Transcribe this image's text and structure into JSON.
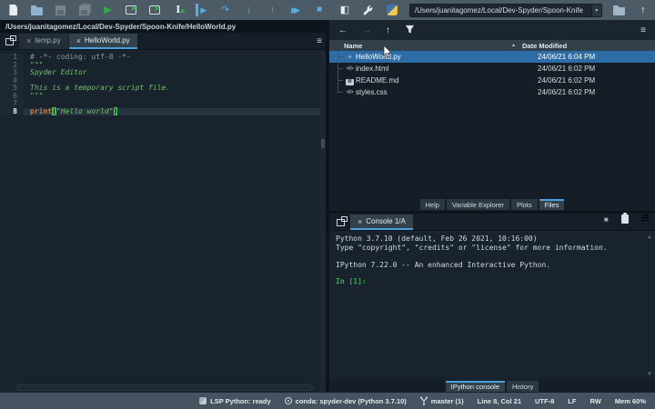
{
  "toolbar": {
    "working_dir": "/Users/juanitagomez/Local/Dev-Spyder/Spoon-Knife"
  },
  "icons": {
    "run": "▶",
    "run_cell_play": "▶",
    "run_selection_play": "▶",
    "debug": "▶",
    "run_current_line": "↷",
    "step_into": "↓",
    "step_return": "↑",
    "continue": "▶▶",
    "stop_debug": "■",
    "maximize_pane": "◧",
    "back": "←",
    "forward": "→",
    "up": "↑",
    "menu": "≡",
    "dropdown": "▾",
    "sort_asc": "▲",
    "scroll_up": "▲",
    "scroll_down": "▼",
    "stop_kernel": "■",
    "ibeam": "I",
    "code_file": "</>",
    "markdown_m": "M",
    "python_file": "✳"
  },
  "editor": {
    "path": "/Users/juanitagomez/Local/Dev-Spyder/Spoon-Knife/HelloWorld.py",
    "tabs": [
      {
        "label": "temp.py",
        "active": false
      },
      {
        "label": "HelloWorld.py",
        "active": true
      }
    ],
    "lines": [
      {
        "num": "1",
        "tokens": [
          {
            "text": "# -*- coding: utf-8 -*-",
            "type": "comment"
          }
        ]
      },
      {
        "num": "2",
        "tokens": [
          {
            "text": "\"\"\"",
            "type": "string"
          }
        ]
      },
      {
        "num": "3",
        "tokens": [
          {
            "text": "Spyder Editor",
            "type": "string"
          }
        ]
      },
      {
        "num": "4",
        "tokens": []
      },
      {
        "num": "5",
        "tokens": [
          {
            "text": "This is a temporary script file.",
            "type": "string"
          }
        ]
      },
      {
        "num": "6",
        "tokens": [
          {
            "text": "\"\"\"",
            "type": "string"
          }
        ]
      },
      {
        "num": "7",
        "tokens": []
      },
      {
        "num": "8",
        "current": true,
        "tokens": [
          {
            "text": "print",
            "type": "builtin"
          },
          {
            "text": "(",
            "type": "paren-match"
          },
          {
            "text": "\"Hello world\"",
            "type": "string"
          },
          {
            "text": ")",
            "type": "paren-match"
          }
        ]
      }
    ]
  },
  "files": {
    "columns": {
      "name": "Name",
      "date": "Date Modified"
    },
    "rows": [
      {
        "name": "HelloWorld.py",
        "date": "24/06/21 6:04 PM",
        "icon": "python-file",
        "selected": true
      },
      {
        "name": "index.html",
        "date": "24/06/21 6:02 PM",
        "icon": "code-file",
        "selected": false
      },
      {
        "name": "README.md",
        "date": "24/06/21 6:02 PM",
        "icon": "markdown-file",
        "selected": false
      },
      {
        "name": "styles.css",
        "date": "24/06/21 6:02 PM",
        "icon": "code-file",
        "selected": false
      }
    ],
    "tabs": [
      {
        "label": "Help",
        "active": false
      },
      {
        "label": "Variable Explorer",
        "active": false
      },
      {
        "label": "Plots",
        "active": false
      },
      {
        "label": "Files",
        "active": true
      }
    ]
  },
  "console": {
    "tab_label": "Console 1/A",
    "lines": [
      "Python 3.7.10 (default, Feb 26 2021, 10:16:00)",
      "Type \"copyright\", \"credits\" or \"license\" for more information.",
      "",
      "IPython 7.22.0 -- An enhanced Interactive Python."
    ],
    "prompt": "In [1]:",
    "tabs": [
      {
        "label": "IPython console",
        "active": true
      },
      {
        "label": "History",
        "active": false
      }
    ]
  },
  "statusbar": {
    "items": [
      {
        "icon": "python",
        "label": "LSP Python: ready"
      },
      {
        "icon": "conda",
        "label": "conda: spyder-dev (Python 3.7.10)"
      },
      {
        "icon": "git-branch",
        "label": "master (1)"
      },
      {
        "icon": "",
        "label": "Line 8, Col 21"
      },
      {
        "icon": "",
        "label": "UTF-8"
      },
      {
        "icon": "",
        "label": "LF"
      },
      {
        "icon": "",
        "label": "RW"
      },
      {
        "icon": "",
        "label": "Mem 60%"
      }
    ]
  },
  "colors": {
    "accent": "#4aa0e0",
    "selection_blue": "#2d6ca4",
    "run_green": "#2fae46",
    "debug_blue": "#57aee6",
    "console_prompt_green": "#2fb344",
    "toolbar_slate": "#4c5b66",
    "pane_bg": "#19232d"
  }
}
